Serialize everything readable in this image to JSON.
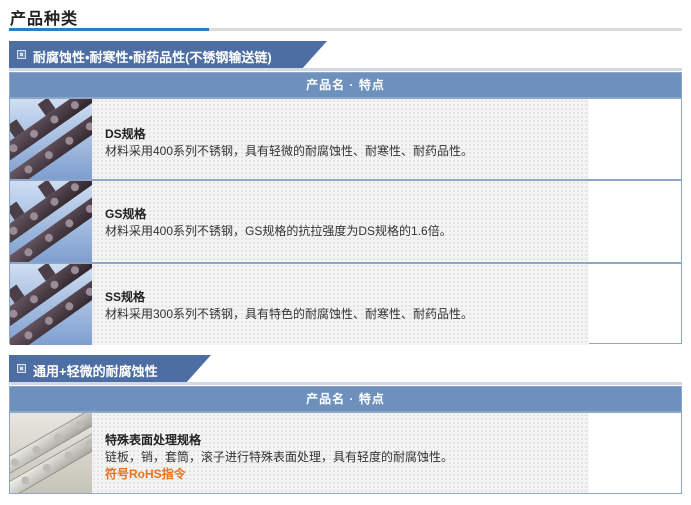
{
  "page": {
    "title": "产品种类"
  },
  "sections": [
    {
      "heading": "耐腐蚀性•耐寒性•耐药品性(不锈钢输送链)",
      "header_label": "产品名 · 特点",
      "rows": [
        {
          "name": "DS规格",
          "desc": "材料采用400系列不锈钢，具有轻微的耐腐蚀性、耐寒性、耐药品性。"
        },
        {
          "name": "GS规格",
          "desc": "材料采用400系列不锈钢，GS规格的抗拉强度为DS规格的1.6倍。"
        },
        {
          "name": "SS规格",
          "desc": "材料采用300系列不锈钢，具有特色的耐腐蚀性、耐寒性、耐药品性。"
        }
      ]
    },
    {
      "heading": "通用+轻微的耐腐蚀性",
      "header_label": "产品名 · 特点",
      "rows": [
        {
          "name": "特殊表面处理规格",
          "desc": "链板，销，套筒，滚子进行特殊表面处理，具有轻度的耐腐蚀性。",
          "note": "符号RoHS指令"
        }
      ]
    }
  ],
  "colors": {
    "accent": "#2a7fc1",
    "tab": "#4c6ea3",
    "table_header": "#6d90bc",
    "note": "#e8711c"
  },
  "icons": {
    "thumb_dark": "dark-chain-image",
    "thumb_silver": "silver-chain-image"
  }
}
